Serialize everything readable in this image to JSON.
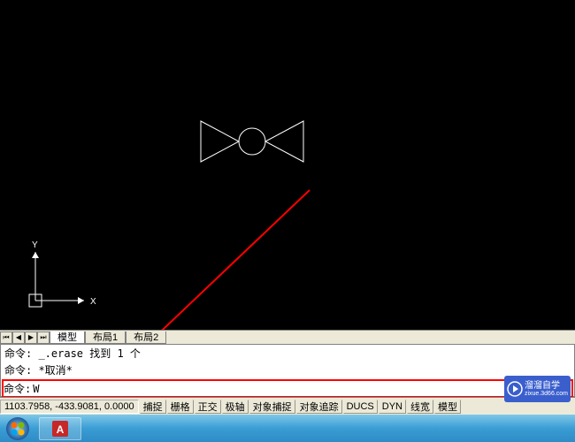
{
  "canvas": {
    "ucs": {
      "x_label": "X",
      "y_label": "Y"
    }
  },
  "tabs": {
    "model": "模型",
    "layout1": "布局1",
    "layout2": "布局2"
  },
  "command_history": {
    "line1": "命令:  _.erase 找到 1 个",
    "line2": "命令: *取消*",
    "prompt": "命令: ",
    "input_value": "W"
  },
  "status": {
    "coords": "1103.7958, -433.9081, 0.0000",
    "buttons": {
      "snap": "捕捉",
      "grid": "栅格",
      "ortho": "正交",
      "polar": "极轴",
      "osnap": "对象捕捉",
      "otrack": "对象追踪",
      "ducs": "DUCS",
      "dyn": "DYN",
      "lwt": "线宽",
      "model": "模型"
    }
  },
  "watermark": {
    "text": "溜溜自学",
    "url": "zixue.3d66.com"
  }
}
